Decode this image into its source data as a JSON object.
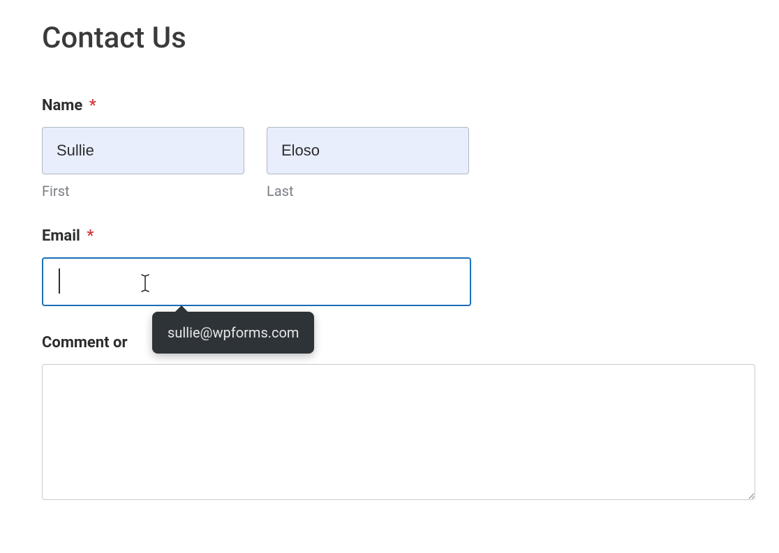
{
  "page": {
    "title": "Contact Us"
  },
  "form": {
    "name": {
      "label": "Name",
      "required_marker": "*",
      "first": {
        "value": "Sullie",
        "sublabel": "First"
      },
      "last": {
        "value": "Eloso",
        "sublabel": "Last"
      }
    },
    "email": {
      "label": "Email",
      "required_marker": "*",
      "value": "",
      "autofill_suggestion": "sullie@wpforms.com"
    },
    "comment": {
      "label": "Comment or",
      "value": ""
    }
  }
}
